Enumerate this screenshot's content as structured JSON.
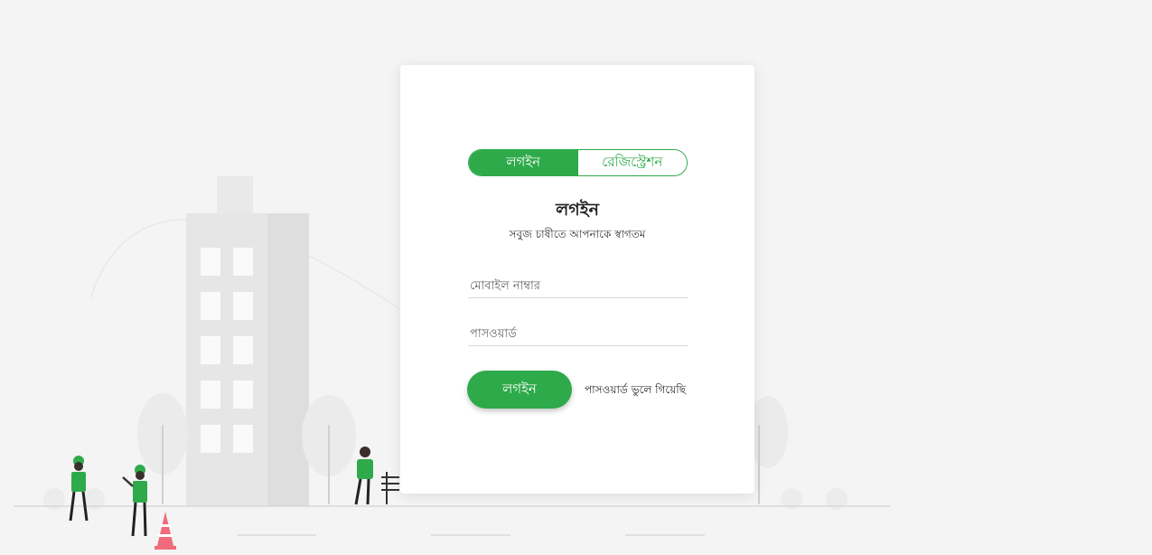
{
  "tabs": {
    "login": "লগইন",
    "registration": "রেজিস্ট্রেশন"
  },
  "form": {
    "title": "লগইন",
    "subtitle": "সবুজ চাষীতে আপনাকে স্বাগতম",
    "mobile_placeholder": "মোবাইল নাম্বার",
    "password_placeholder": "পাসওয়ার্ড",
    "login_button": "লগইন",
    "forgot_password": "পাসওয়ার্ড ভুলে গিয়েছি"
  },
  "colors": {
    "accent": "#2eaa4a",
    "background": "#f4f4f4",
    "illustration_gray": "#e6e6e6",
    "cone": "#f06b7b"
  },
  "illustration": {
    "icons": [
      "building-icon",
      "tree-icon",
      "worker-icon",
      "traffic-cone-icon",
      "sign-icon"
    ]
  }
}
